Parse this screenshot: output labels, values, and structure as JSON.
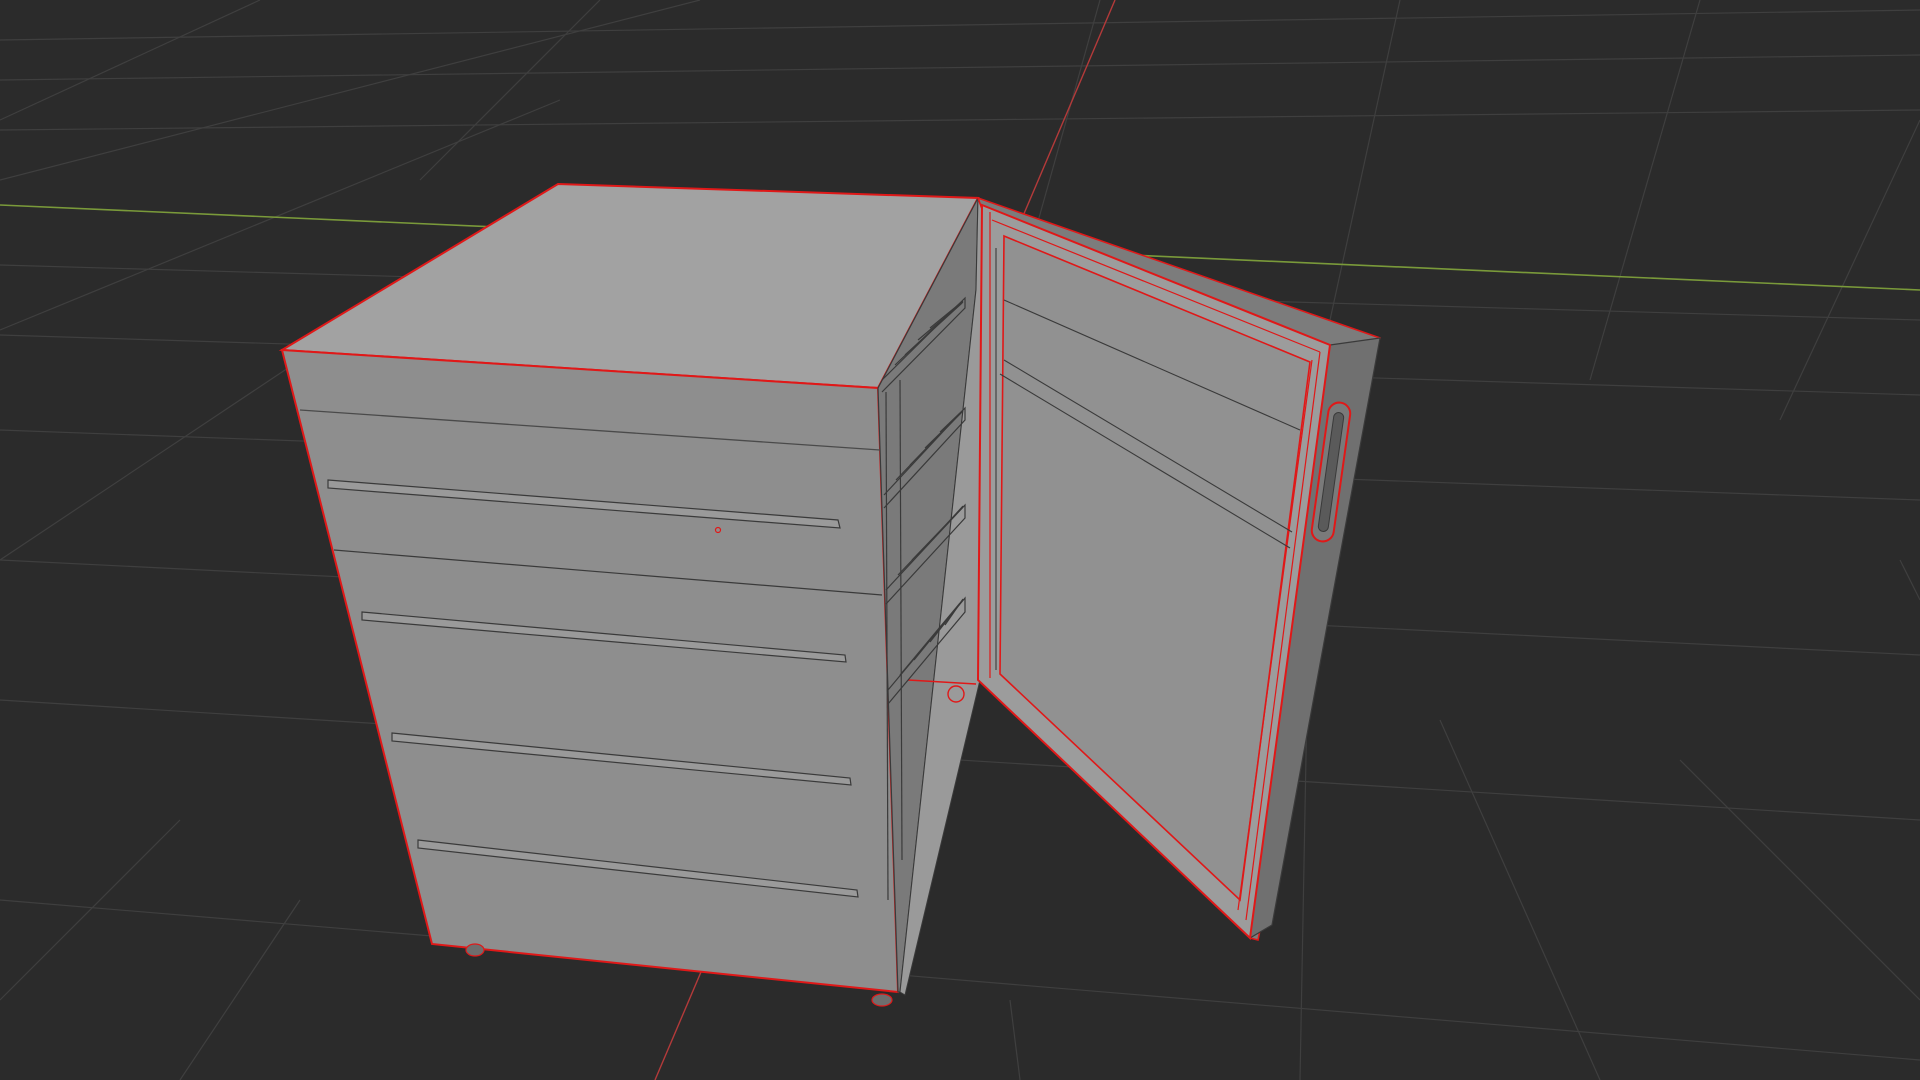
{
  "viewport": {
    "background_color": "#2b2b2b",
    "grid_color": "#3d3d3d",
    "x_axis_color": "#b33a3a",
    "y_axis_color": "#7a9a3a",
    "selection_outline_color": "#e01818",
    "mesh_face_light": "#a4a4a4",
    "mesh_face_mid": "#8e8e8e",
    "mesh_face_dark": "#6e6e6e",
    "wire_color": "#3a3a3a"
  },
  "scene": {
    "object": "refrigerator-mesh",
    "mode": "edit-mode",
    "door_state": "open",
    "shelf_count": 4,
    "front_panel_grooves": 5
  }
}
